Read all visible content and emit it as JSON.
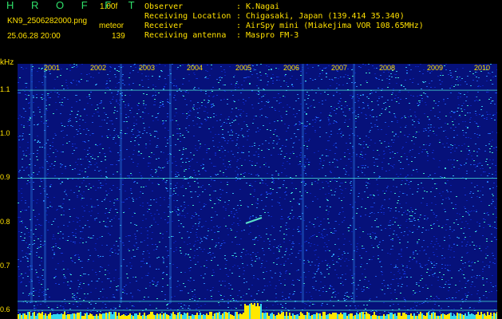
{
  "header": {
    "brand": "H R O F F T",
    "version": "1.00f",
    "file_name": "KN9_2506282000.png",
    "meteor_label": "meteor",
    "datetime": "25.06.28 20:00",
    "meteor_count": "139",
    "info": [
      {
        "key": "Observer",
        "value": ": K.Nagai"
      },
      {
        "key": "Receiving Location",
        "value": ": Chigasaki, Japan (139.414 35.340)"
      },
      {
        "key": "Receiver",
        "value": ": AirSpy mini (Miakejima VOR 108.65MHz)"
      },
      {
        "key": "Receiving antenna",
        "value": ": Maspro FM-3"
      }
    ]
  },
  "colors": {
    "background": "#000000",
    "text": "#ffe000",
    "brand": "#2fe06a",
    "noise_base": "#06117a",
    "noise_hi": "#39d3c8"
  },
  "chart_data": {
    "type": "heatmap",
    "xlabel": "",
    "ylabel": "kHz",
    "x_ticks": [
      "2001",
      "2002",
      "2003",
      "2004",
      "2005",
      "2006",
      "2007",
      "2008",
      "2009",
      "2010"
    ],
    "y_ticks": [
      "1.1",
      "1.0",
      "0.9",
      "0.8",
      "0.7",
      "0.6"
    ],
    "ylim": [
      0.58,
      1.16
    ],
    "horizontal_lines_khz": [
      1.1,
      0.9,
      0.62,
      0.6
    ]
  }
}
